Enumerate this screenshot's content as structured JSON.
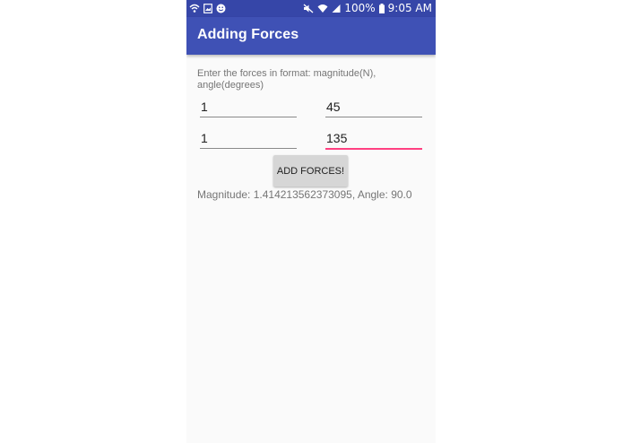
{
  "status_bar": {
    "battery": "100%",
    "time": "9:05 AM"
  },
  "app_bar": {
    "title": "Adding Forces"
  },
  "form": {
    "instructions": "Enter the forces in format: magnitude(N), angle(degrees)",
    "force1": {
      "magnitude": "1",
      "angle": "45"
    },
    "force2": {
      "magnitude": "1",
      "angle": "135"
    },
    "button_label": "ADD FORCES!"
  },
  "result": {
    "text": "Magnitude: 1.414213562373095, Angle: 90.0"
  },
  "colors": {
    "primary": "#3f51b5",
    "primary_dark": "#3646a8",
    "accent": "#ff4081"
  }
}
